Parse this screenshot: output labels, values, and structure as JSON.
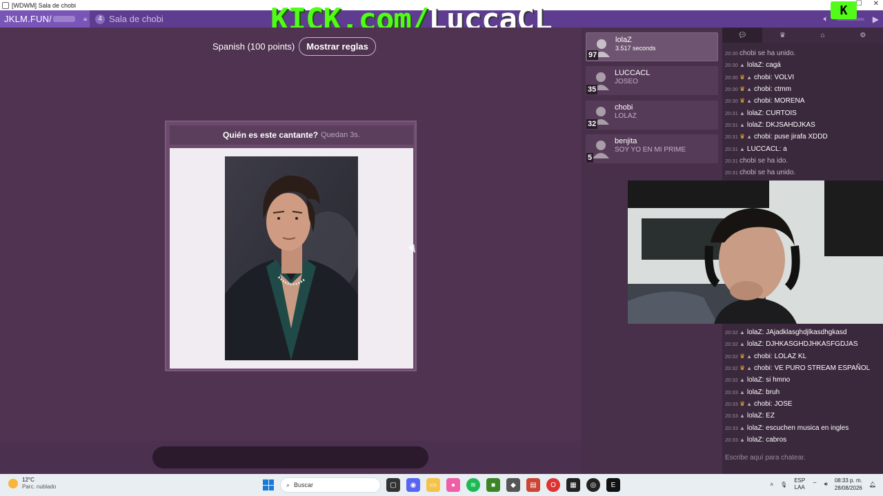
{
  "window": {
    "title": "[WDWM] Sala de chobi"
  },
  "header": {
    "site_name": "JKLM.FUN/",
    "room_player_count": "4",
    "room_name": "Sala de chobi"
  },
  "overlay": {
    "stream_prefix": "KICK.com/",
    "stream_user": "LuccaCL",
    "logo_letter": "K"
  },
  "game": {
    "language_label": "Spanish (100 points)",
    "rules_button": "Mostrar reglas",
    "question": "Quién es este cantante?",
    "timer": "Quedan 3s."
  },
  "players": [
    {
      "name": "lolaZ",
      "subtitle": "3.517 seconds",
      "score": "97"
    },
    {
      "name": "LUCCACL",
      "subtitle": "JOSEO",
      "score": "35"
    },
    {
      "name": "chobi",
      "subtitle": "LOLAZ",
      "score": "32"
    },
    {
      "name": "benjita",
      "subtitle": "SOY YO EN MI PRIME",
      "score": "5"
    }
  ],
  "chat": {
    "tabs": [
      "chat-icon",
      "trophy-icon",
      "home-icon",
      "gear-icon"
    ],
    "messages_top": [
      {
        "time": "20:30",
        "sys": true,
        "text": "chobi se ha unido."
      },
      {
        "time": "20:30",
        "user": "lolaZ",
        "crown": false,
        "text": "cagá"
      },
      {
        "time": "20:30",
        "user": "chobi",
        "crown": true,
        "text": "VOLVI"
      },
      {
        "time": "20:30",
        "user": "chobi",
        "crown": true,
        "text": "ctmm"
      },
      {
        "time": "20:30",
        "user": "chobi",
        "crown": true,
        "text": "MORENA"
      },
      {
        "time": "20:31",
        "user": "lolaZ",
        "crown": false,
        "text": "CURTOIS"
      },
      {
        "time": "20:31",
        "user": "lolaZ",
        "crown": false,
        "text": "DKJSAHDJKAS"
      },
      {
        "time": "20:31",
        "user": "chobi",
        "crown": true,
        "text": "puse jirafa XDDD"
      },
      {
        "time": "20:31",
        "user": "LUCCACL",
        "crown": false,
        "text": "a"
      },
      {
        "time": "20:31",
        "sys": true,
        "text": "chobi se ha ido."
      },
      {
        "time": "20:31",
        "sys": true,
        "text": "chobi se ha unido."
      }
    ],
    "messages_bottom": [
      {
        "time": "20:32",
        "user": "lolaZ",
        "crown": false,
        "text": "JAjadklasghdjlkasdhgkasd"
      },
      {
        "time": "20:32",
        "user": "lolaZ",
        "crown": false,
        "text": "DJHKASGHDJHKASFGDJAS"
      },
      {
        "time": "20:32",
        "user": "chobi",
        "crown": true,
        "text": "LOLAZ KL"
      },
      {
        "time": "20:32",
        "user": "chobi",
        "crown": true,
        "text": "VE PURO STREAM ESPAÑOL"
      },
      {
        "time": "20:32",
        "user": "lolaZ",
        "crown": false,
        "text": "si hmno"
      },
      {
        "time": "20:33",
        "user": "lolaZ",
        "crown": false,
        "text": "bruh"
      },
      {
        "time": "20:33",
        "user": "chobi",
        "crown": true,
        "text": "JOSE"
      },
      {
        "time": "20:33",
        "user": "lolaZ",
        "crown": false,
        "text": "EZ"
      },
      {
        "time": "20:33",
        "user": "lolaZ",
        "crown": false,
        "text": "escuchen musica en ingles"
      },
      {
        "time": "20:33",
        "user": "lolaZ",
        "crown": false,
        "text": "cabros"
      }
    ],
    "input_placeholder": "Escribe aquí para chatear."
  },
  "taskbar": {
    "temperature": "12°C",
    "condition": "Parc. nublado",
    "search_placeholder": "Buscar",
    "lang_top": "ESP",
    "lang_bottom": "LAA",
    "time": "08:33 p. m.",
    "date": "28/08/2026"
  },
  "colors": {
    "background": "#4f3350",
    "header": "#5e3c8f",
    "kick_green": "#53fc18",
    "crown": "#f0b12d"
  }
}
